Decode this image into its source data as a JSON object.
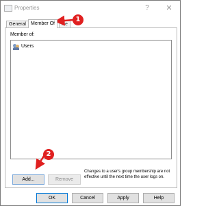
{
  "window": {
    "title": "Properties",
    "help_glyph": "?",
    "close_glyph": "✕"
  },
  "tabs": [
    {
      "label": "General"
    },
    {
      "label": "Member Of"
    },
    {
      "label": "file"
    }
  ],
  "member_label": "Member of:",
  "members": [
    {
      "label": "Users",
      "icon": "users-group-icon"
    }
  ],
  "buttons": {
    "add": "Add...",
    "remove": "Remove"
  },
  "note": "Changes to a user's group membership are not effective until the next time the user logs on.",
  "footer": {
    "ok": "OK",
    "cancel": "Cancel",
    "apply": "Apply",
    "help": "Help"
  },
  "annotations": [
    {
      "number": "1",
      "color": "#e02020"
    },
    {
      "number": "2",
      "color": "#e02020"
    }
  ]
}
